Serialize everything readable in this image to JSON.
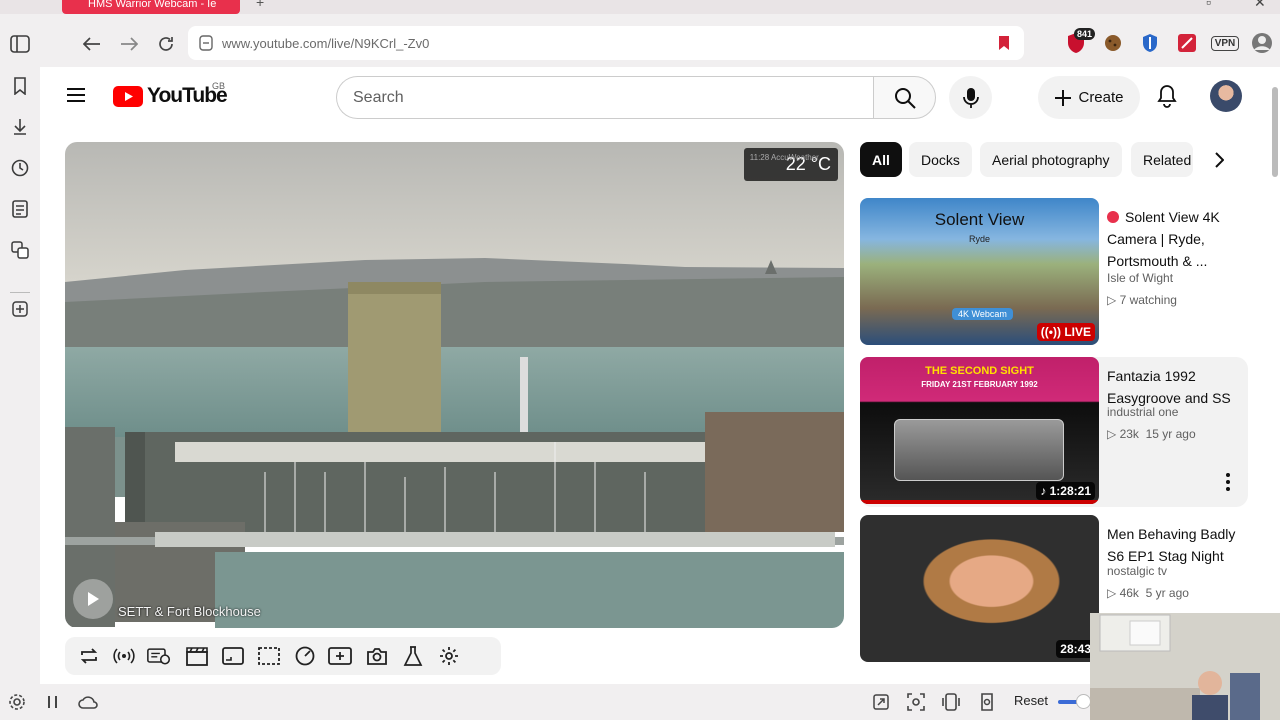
{
  "browser": {
    "tab_title": "HMS Warrior Webcam - Ie",
    "url": "www.youtube.com/live/N9KCrl_-Zv0",
    "extension_badge": "841",
    "vpn_label": "VPN"
  },
  "youtube": {
    "logo_text": "YouTube",
    "country_code": "GB",
    "search_placeholder": "Search",
    "create_label": "Create"
  },
  "video": {
    "temperature": "22 °C",
    "weather_small": "11:28 AccuWeather",
    "camera_label": "SETT & Fort Blockhouse"
  },
  "chips": [
    "All",
    "Docks",
    "Aerial photography",
    "Related"
  ],
  "recommendations": [
    {
      "title": "Solent View 4K Camera | Ryde, Portsmouth & ...",
      "channel": "Isle of Wight",
      "meta": "7 watching",
      "badge": "LIVE",
      "thumb_title": "Solent View",
      "thumb_sub": "Ryde",
      "thumb_tag": "4K Webcam"
    },
    {
      "title": "Fantazia 1992 Easygroove and SS",
      "channel": "industrial one",
      "views": "23k",
      "age": "15 yr ago",
      "duration": "1:28:21",
      "thumb_title": "THE SECOND SIGHT",
      "thumb_sub": "FRIDAY 21ST FEBRUARY 1992"
    },
    {
      "title": "Men Behaving Badly S6 EP1  Stag Night",
      "channel": "nostalgic tv",
      "views": "46k",
      "age": "5 yr ago",
      "duration": "28:43"
    }
  ],
  "bottom_bar": {
    "reset_label": "Reset"
  },
  "colors": {
    "youtube_red": "#ff0000",
    "tab_red": "#e8304c",
    "live_red": "#cc0000",
    "slider_blue": "#3b6bd6"
  }
}
